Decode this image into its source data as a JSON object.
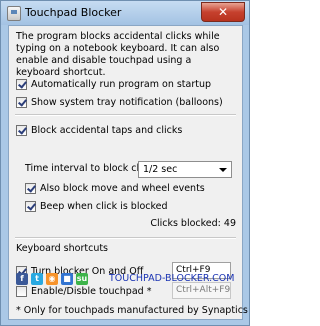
{
  "window": {
    "title": "Touchpad Blocker",
    "close_symbol": "✕"
  },
  "description": "The program blocks accidental clicks while typing on a notebook keyboard. It can also enable and disable touchpad using a keyboard shortcut.",
  "options": {
    "autorun": {
      "label": "Automatically run program on startup",
      "checked": true
    },
    "tray": {
      "label": "Show system tray notification (balloons)",
      "checked": true
    },
    "block_taps": {
      "label": "Block accidental taps and clicks",
      "checked": true
    },
    "interval_label": "Time interval to block clicks",
    "interval_value": "1/2 sec",
    "block_move": {
      "label": "Also block move and wheel events",
      "checked": true
    },
    "beep": {
      "label": "Beep when click is blocked",
      "checked": true
    },
    "clicks_blocked": "Clicks blocked: 49"
  },
  "shortcuts": {
    "heading": "Keyboard shortcuts",
    "toggle": {
      "label": "Turn blocker On and Off",
      "checked": true,
      "value": "Ctrl+F9"
    },
    "touchpad": {
      "label": "Enable/Disble touchpad *",
      "checked": false,
      "value": "Ctrl+Alt+F9"
    },
    "note": "* Only for touchpads manufactured by Synaptics"
  },
  "footer": {
    "icons": [
      {
        "name": "facebook-icon",
        "glyph": "f",
        "color": "#3b5998"
      },
      {
        "name": "twitter-icon",
        "glyph": "t",
        "color": "#29a9e1"
      },
      {
        "name": "rss-icon",
        "glyph": "◉",
        "color": "#f7932a"
      },
      {
        "name": "delicious-icon",
        "glyph": "■",
        "color": "#3274d1"
      },
      {
        "name": "stumbleupon-icon",
        "glyph": "su",
        "color": "#3db44a"
      }
    ],
    "link": "TOUCHPAD-BLOCKER.COM"
  }
}
